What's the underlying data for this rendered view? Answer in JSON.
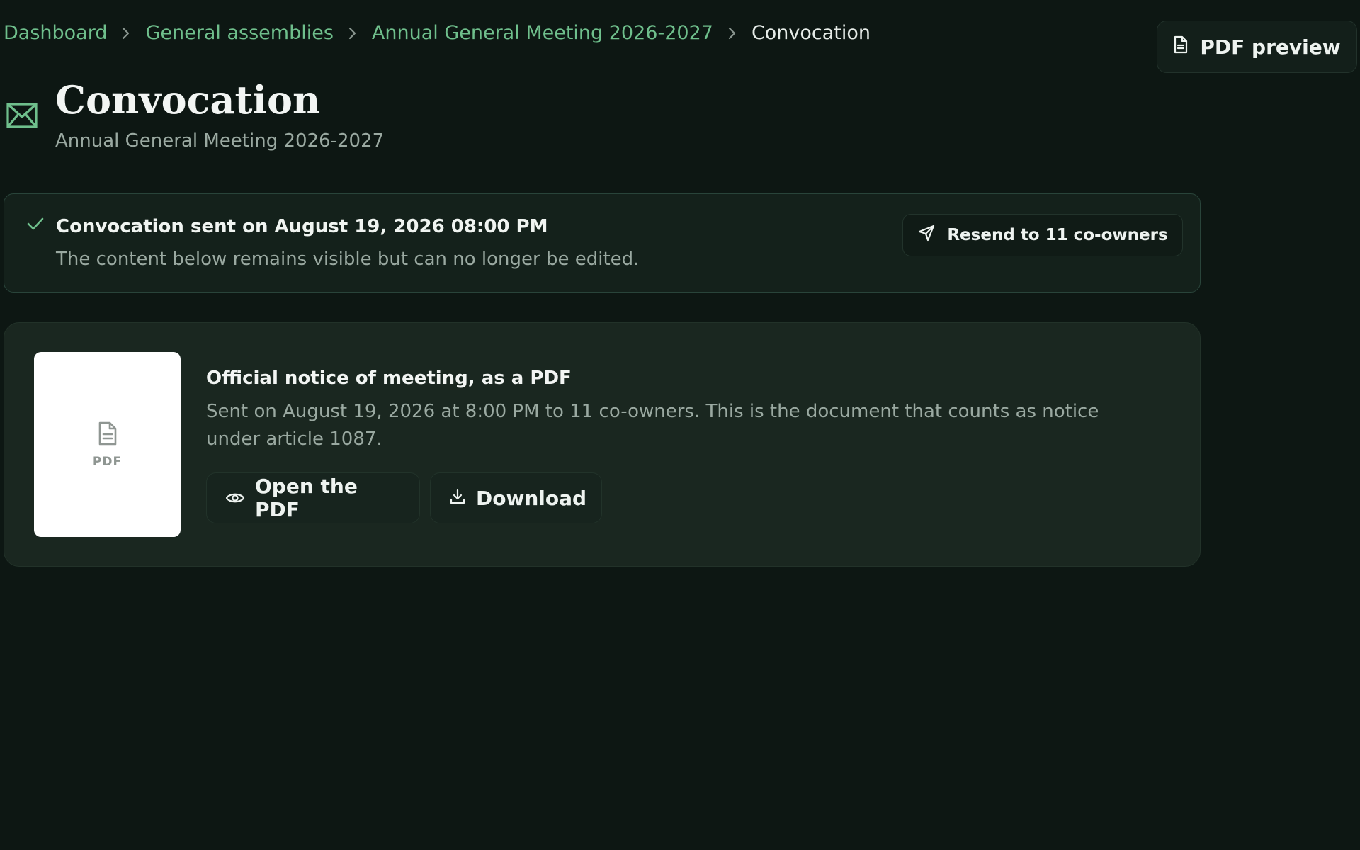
{
  "breadcrumb": {
    "items": [
      {
        "label": "Dashboard"
      },
      {
        "label": "General assemblies"
      },
      {
        "label": "Annual General Meeting 2026-2027"
      }
    ],
    "current": "Convocation"
  },
  "header": {
    "title": "Convocation",
    "subtitle": "Annual General Meeting 2026-2027",
    "title_icon": "envelope-icon",
    "pdf_preview_label": "PDF preview",
    "pdf_preview_icon": "file-icon"
  },
  "status": {
    "icon": "check-icon",
    "title": "Convocation sent on August 19, 2026 08:00 PM",
    "description": "The content below remains visible but can no longer be edited.",
    "resend_label": "Resend to 11 co-owners",
    "resend_icon": "send-icon"
  },
  "document": {
    "thumbnail_label": "PDF",
    "thumbnail_icon": "file-icon",
    "title": "Official notice of meeting, as a PDF",
    "description": "Sent on August 19, 2026 at 8:00 PM to 11 co-owners. This is the document that counts as notice under article 1087.",
    "open_label": "Open the PDF",
    "open_icon": "eye-icon",
    "download_label": "Download",
    "download_icon": "download-icon"
  },
  "colors": {
    "background": "#0d1713",
    "accent": "#6fbf8c",
    "card": "#1a2720",
    "muted_text": "#9aa9a1"
  }
}
